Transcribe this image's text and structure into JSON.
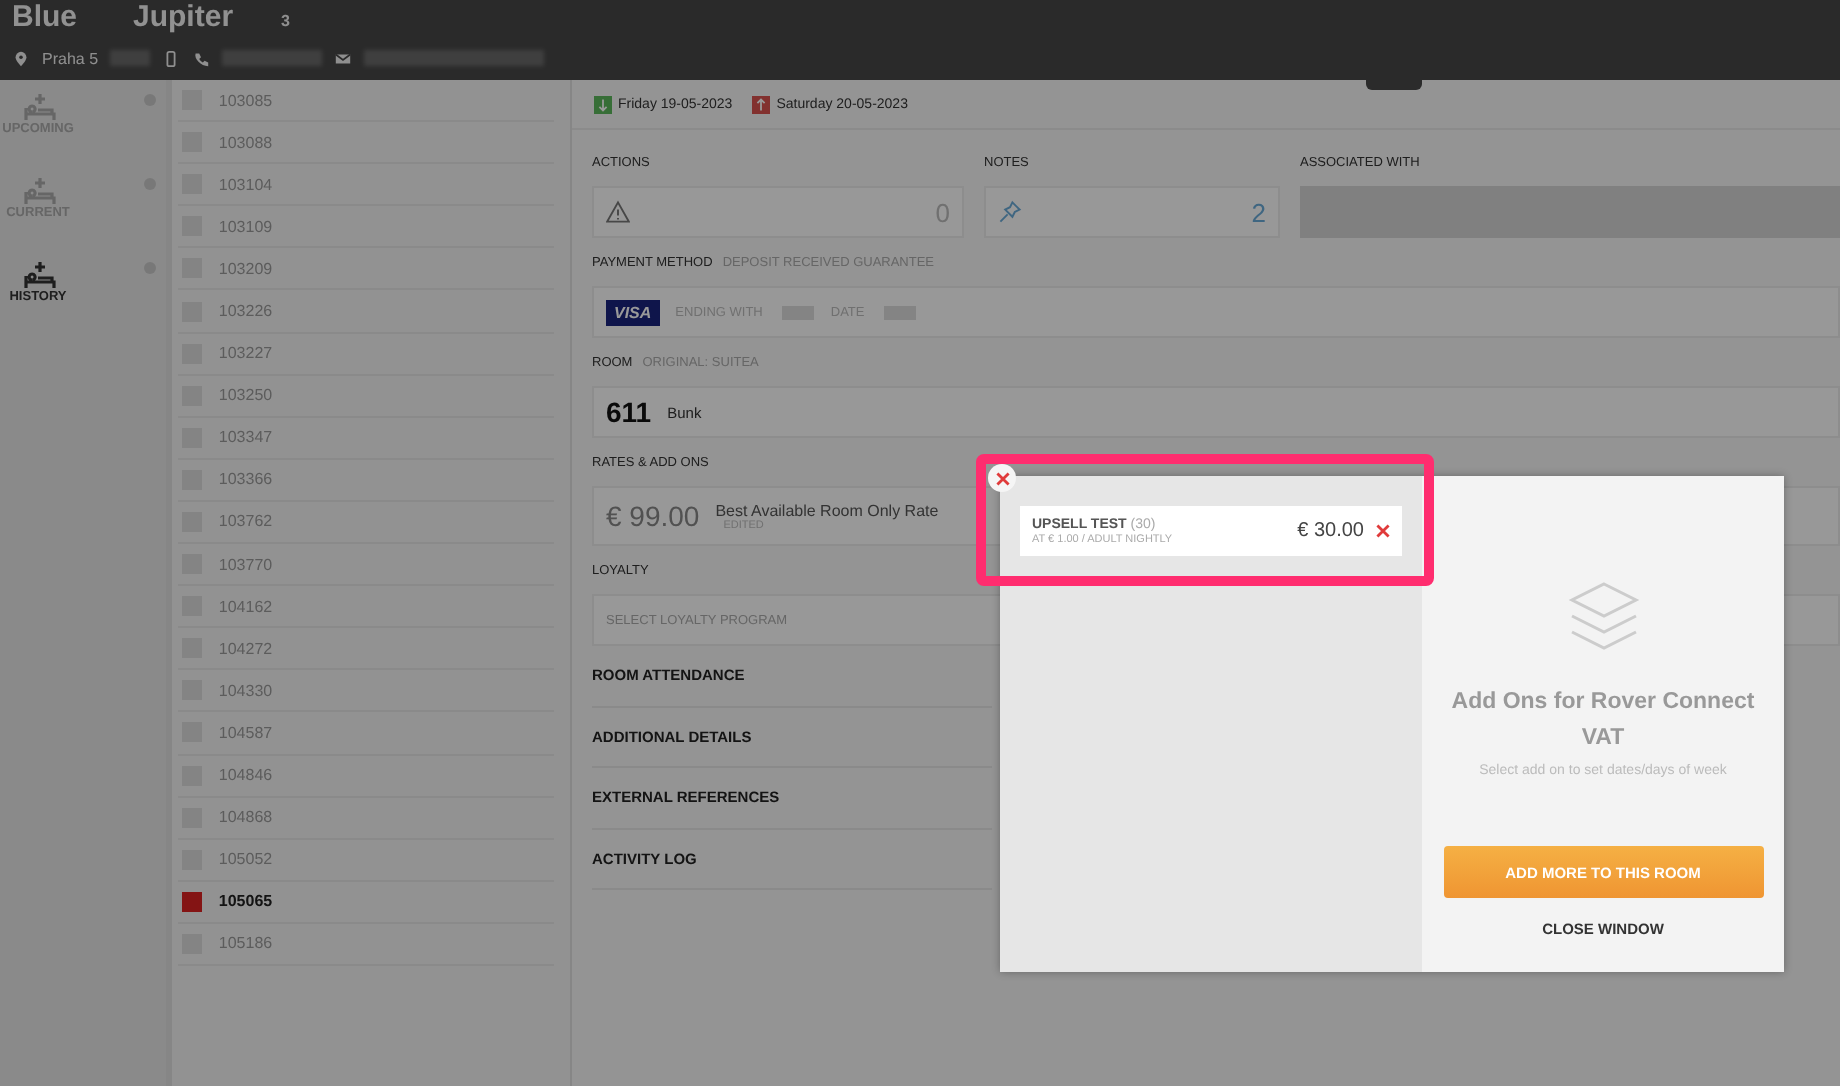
{
  "header": {
    "hotel": "Blue",
    "guest": "Jupiter",
    "badge": "3",
    "location": "Praha 5"
  },
  "nav": [
    {
      "label": "UPCOMING",
      "selected": false
    },
    {
      "label": "CURRENT",
      "selected": false
    },
    {
      "label": "HISTORY",
      "selected": true
    }
  ],
  "bookings": [
    {
      "number": "103085",
      "selected": false
    },
    {
      "number": "103088",
      "selected": false
    },
    {
      "number": "103104",
      "selected": false
    },
    {
      "number": "103109",
      "selected": false
    },
    {
      "number": "103209",
      "selected": false
    },
    {
      "number": "103226",
      "selected": false
    },
    {
      "number": "103227",
      "selected": false
    },
    {
      "number": "103250",
      "selected": false
    },
    {
      "number": "103347",
      "selected": false
    },
    {
      "number": "103366",
      "selected": false
    },
    {
      "number": "103762",
      "selected": false
    },
    {
      "number": "103770",
      "selected": false
    },
    {
      "number": "104162",
      "selected": false
    },
    {
      "number": "104272",
      "selected": false
    },
    {
      "number": "104330",
      "selected": false
    },
    {
      "number": "104587",
      "selected": false
    },
    {
      "number": "104846",
      "selected": false
    },
    {
      "number": "104868",
      "selected": false
    },
    {
      "number": "105052",
      "selected": false
    },
    {
      "number": "105065",
      "selected": true
    },
    {
      "number": "105186",
      "selected": false
    }
  ],
  "dates": {
    "arrival": "Friday 19-05-2023",
    "departure": "Saturday 20-05-2023"
  },
  "actions": {
    "label": "ACTIONS",
    "count": "0"
  },
  "notes": {
    "label": "NOTES",
    "count": "2"
  },
  "associated": {
    "label": "ASSOCIATED WITH"
  },
  "payment": {
    "label": "PAYMENT METHOD",
    "status": "DEPOSIT RECEIVED GUARANTEE",
    "card": "VISA",
    "ending_label": "ENDING WITH",
    "date_label": "DATE"
  },
  "room": {
    "label": "ROOM",
    "original": "ORIGINAL: SUITEA",
    "number": "611",
    "type": "Bunk"
  },
  "rates": {
    "label": "RATES & ADD ONS",
    "price": "€ 99.00",
    "name": "Best Available Room Only Rate",
    "note": "EDITED"
  },
  "loyalty": {
    "label": "LOYALTY",
    "placeholder": "SELECT LOYALTY PROGRAM"
  },
  "sections": [
    "ROOM ATTENDANCE",
    "ADDITIONAL DETAILS",
    "EXTERNAL REFERENCES",
    "ACTIVITY LOG"
  ],
  "modal": {
    "addons": [
      {
        "name": "UPSELL TEST",
        "count": "(30)",
        "detail": "AT € 1.00 / ADULT NIGHTLY",
        "price": "€ 30.00"
      }
    ],
    "title": "Add Ons for Rover Connect VAT",
    "hint": "Select add on to set dates/days of week",
    "add_button": "ADD MORE TO THIS ROOM",
    "close": "CLOSE WINDOW"
  }
}
